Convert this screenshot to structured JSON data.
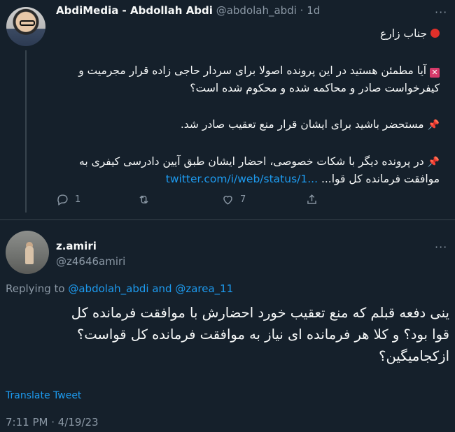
{
  "parent": {
    "display_name": "AbdiMedia - Abdollah Abdi",
    "handle": "@abdolah_abdi",
    "time": "· 1d",
    "line1": "جناب زارع",
    "line2": "آیا مطمئن هستید در این پرونده اصولا برای سردار حاجی زاده قرار مجرمیت و",
    "line3": "کیفرخواست صادر و محاکمه شده و محکوم شده است؟",
    "line4": "مستحضر باشید برای ایشان قرار منع تعقیب صادر شد.",
    "line5": "در پرونده دیگر با شکات خصوصی، احضار ایشان طبق آیین دادرسی کیفری به",
    "line6_text": "موافقت فرمانده کل قوا...",
    "line6_link": "twitter.com/i/web/status/1...",
    "reply_count": "1",
    "retweet_count": "",
    "like_count": "7",
    "icons": [
      "reply-icon",
      "retweet-icon",
      "like-icon",
      "share-icon",
      "more-icon"
    ]
  },
  "reply": {
    "display_name": "z.amiri",
    "handle": "@z4646amiri",
    "replying_prefix": "Replying to",
    "replying_user1": "@abdolah_abdi",
    "replying_and": "and",
    "replying_user2": "@zarea_11",
    "body_line1": "ینی دفعه قبلم که منع تعقیب خورد احضارش با موافقت فرمانده کل",
    "body_line2": "قوا بود؟ و کلا هر فرمانده ای نیاز به موافقت فرمانده کل قواست؟",
    "body_line3": "ازکجامیگین؟",
    "translate": "Translate Tweet",
    "timestamp": "7:11 PM · 4/19/23"
  },
  "colors": {
    "background": "#15202b",
    "text": "#f7f9f9",
    "muted": "#8b98a5",
    "link": "#1d9bf0",
    "divider": "#38444d"
  }
}
